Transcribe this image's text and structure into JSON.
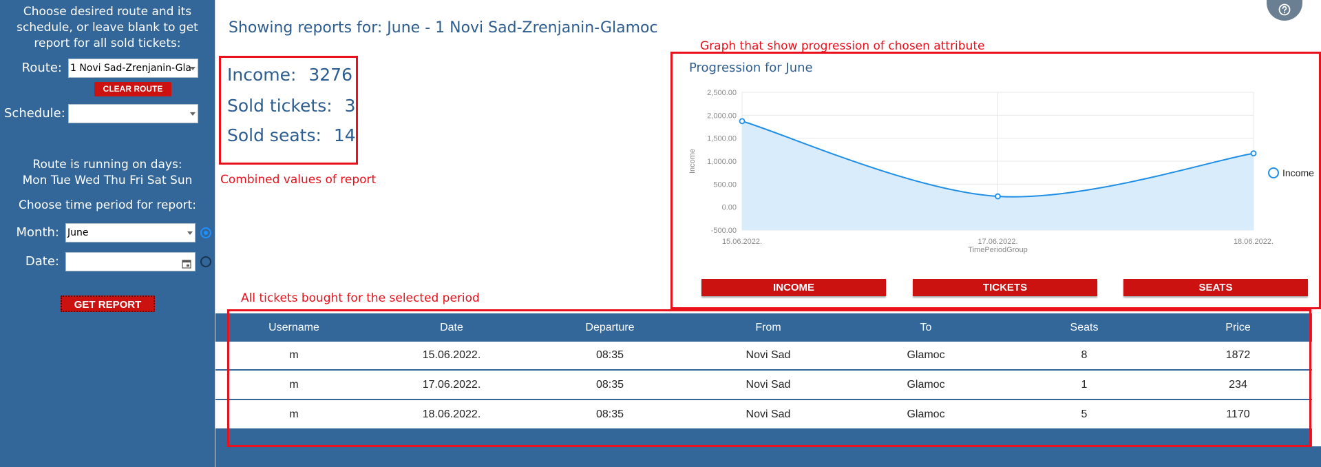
{
  "sidebar": {
    "intro": [
      "Choose desired route and its",
      "schedule, or leave blank to get",
      "report for all sold tickets:"
    ],
    "route_label": "Route:",
    "route_value": "1 Novi Sad-Zrenjanin-Gla",
    "clear_route": "CLEAR ROUTE",
    "schedule_label": "Schedule:",
    "schedule_value": "",
    "running_days_title": "Route is running on days:",
    "running_days": "Mon Tue Wed Thu Fri Sat Sun",
    "period_prompt": "Choose time period for report:",
    "month_label": "Month:",
    "month_value": "June",
    "date_label": "Date:",
    "date_value": "",
    "get_report": "GET REPORT"
  },
  "header": {
    "title": "Showing reports for: June - 1 Novi Sad-Zrenjanin-Glamoc"
  },
  "stats": {
    "income_label": "Income:",
    "income_value": "3276",
    "tickets_label": "Sold tickets:",
    "tickets_value": "3",
    "seats_label": "Sold seats:",
    "seats_value": "14"
  },
  "annotations": {
    "graph": "Graph that show progression of chosen attribute",
    "combined": "Combined values of report",
    "tickets": "All tickets bought for the selected period"
  },
  "chart_buttons": {
    "income": "INCOME",
    "tickets": "TICKETS",
    "seats": "SEATS"
  },
  "chart_data": {
    "type": "area",
    "title": "Progression for June",
    "xlabel": "TimePeriodGroup",
    "ylabel": "Income",
    "categories": [
      "15.06.2022.",
      "17.06.2022.",
      "18.06.2022."
    ],
    "series": [
      {
        "name": "Income",
        "values": [
          1872,
          234,
          1170
        ]
      }
    ],
    "yticks": [
      "2,500.00",
      "2,000.00",
      "1,500.00",
      "1,000.00",
      "500.00",
      "0.00",
      "-500.00"
    ],
    "ylim": [
      -500,
      2500
    ],
    "grid": true,
    "legend": "right",
    "line_color": "#1f8ee6",
    "fill_color": "#d9ecfb"
  },
  "table": {
    "columns": [
      "Username",
      "Date",
      "Departure",
      "From",
      "To",
      "Seats",
      "Price"
    ],
    "rows": [
      [
        "m",
        "15.06.2022.",
        "08:35",
        "Novi Sad",
        "Glamoc",
        "8",
        "1872"
      ],
      [
        "m",
        "17.06.2022.",
        "08:35",
        "Novi Sad",
        "Glamoc",
        "1",
        "234"
      ],
      [
        "m",
        "18.06.2022.",
        "08:35",
        "Novi Sad",
        "Glamoc",
        "5",
        "1170"
      ]
    ]
  },
  "icons": {
    "help": "question-circle-icon",
    "calendar": "calendar-icon"
  }
}
